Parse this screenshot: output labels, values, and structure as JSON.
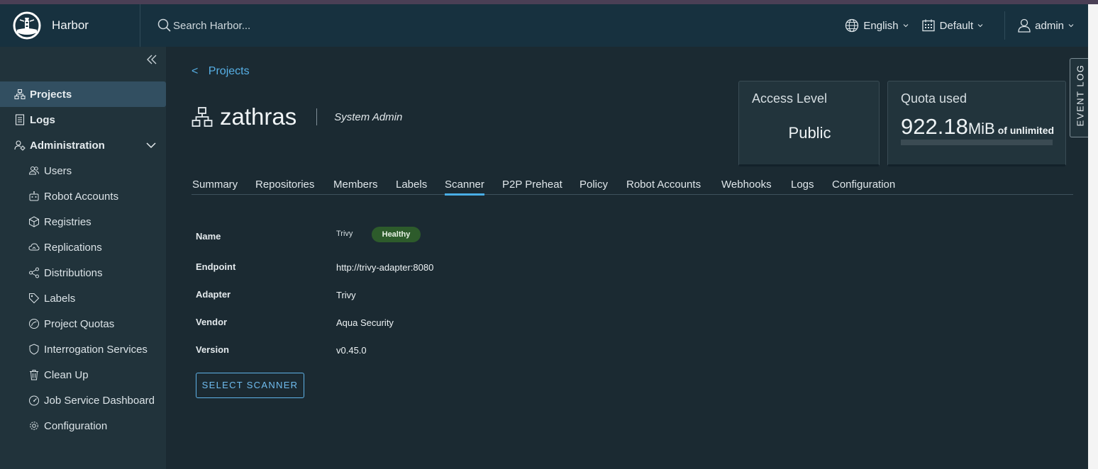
{
  "app": {
    "name": "Harbor"
  },
  "header": {
    "search_placeholder": "Search Harbor...",
    "language": "English",
    "timezone": "Default",
    "user": "admin"
  },
  "sidebar": {
    "items": [
      {
        "label": "Projects",
        "icon": "projects-icon",
        "active": true
      },
      {
        "label": "Logs",
        "icon": "logs-icon"
      },
      {
        "label": "Administration",
        "icon": "administration-icon",
        "expanded": true
      }
    ],
    "admin_items": [
      {
        "label": "Users",
        "icon": "users-icon"
      },
      {
        "label": "Robot Accounts",
        "icon": "robot-icon"
      },
      {
        "label": "Registries",
        "icon": "registries-icon"
      },
      {
        "label": "Replications",
        "icon": "replications-icon"
      },
      {
        "label": "Distributions",
        "icon": "distributions-icon"
      },
      {
        "label": "Labels",
        "icon": "labels-icon"
      },
      {
        "label": "Project Quotas",
        "icon": "quotas-icon"
      },
      {
        "label": "Interrogation Services",
        "icon": "shield-icon"
      },
      {
        "label": "Clean Up",
        "icon": "trash-icon"
      },
      {
        "label": "Job Service Dashboard",
        "icon": "dashboard-icon"
      },
      {
        "label": "Configuration",
        "icon": "gear-icon"
      }
    ]
  },
  "breadcrumb": {
    "arrow": "<",
    "label": "Projects"
  },
  "project": {
    "name": "zathras",
    "role": "System Admin"
  },
  "cards": {
    "access": {
      "title": "Access Level",
      "value": "Public"
    },
    "quota": {
      "title": "Quota used",
      "value": "922.18",
      "unit": "MiB",
      "of": "of unlimited"
    }
  },
  "event_log": "EVENT LOG",
  "tabs": [
    {
      "label": "Summary"
    },
    {
      "label": "Repositories"
    },
    {
      "label": "Members"
    },
    {
      "label": "Labels"
    },
    {
      "label": "Scanner",
      "active": true
    },
    {
      "label": "P2P Preheat"
    },
    {
      "label": "Policy"
    },
    {
      "label": "Robot Accounts"
    },
    {
      "label": "Webhooks"
    },
    {
      "label": "Logs"
    },
    {
      "label": "Configuration"
    }
  ],
  "scanner": {
    "name_label": "Name",
    "name_value": "Trivy",
    "status": "Healthy",
    "endpoint_label": "Endpoint",
    "endpoint_value": "http://trivy-adapter:8080",
    "adapter_label": "Adapter",
    "adapter_value": "Trivy",
    "vendor_label": "Vendor",
    "vendor_value": "Aqua Security",
    "version_label": "Version",
    "version_value": "v0.45.0",
    "select_button": "SELECT SCANNER"
  },
  "colors": {
    "header_bg": "#17313f",
    "sidebar_bg": "#21333b",
    "content_bg": "#1b2a32",
    "accent": "#49aee6",
    "healthy": "#2d5b2b"
  }
}
